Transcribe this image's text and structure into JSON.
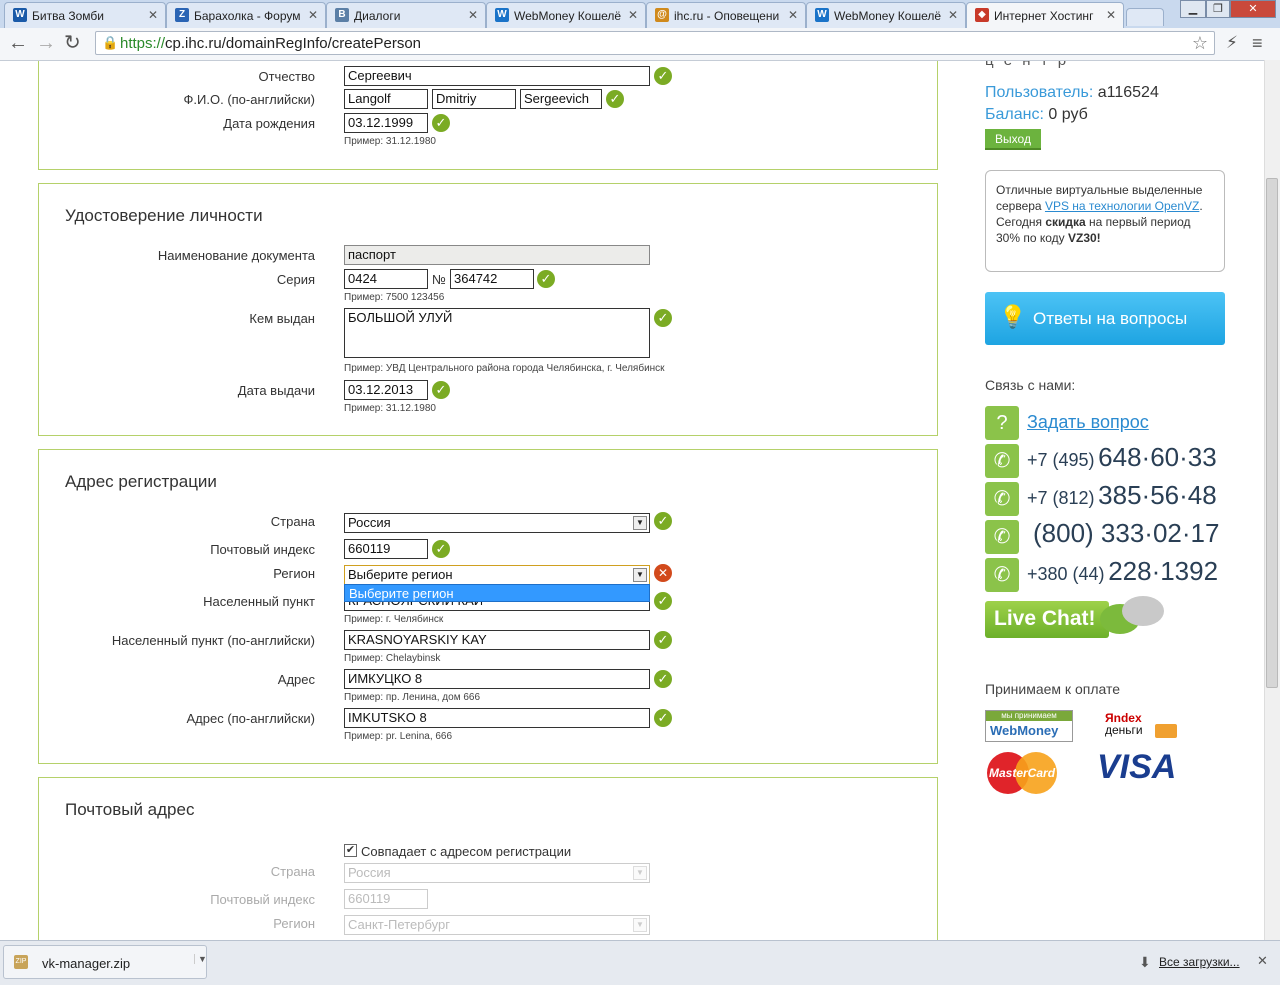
{
  "tabs": [
    {
      "title": "Битва Зомби",
      "icon": "W",
      "color": "#1a5aa8"
    },
    {
      "title": "Барахолка - Форум",
      "icon": "Z",
      "color": "#2a64b4"
    },
    {
      "title": "Диалоги",
      "icon": "В",
      "color": "#5b7fa6"
    },
    {
      "title": "WebMoney Кошелё",
      "icon": "W",
      "color": "#1a73c8"
    },
    {
      "title": "ihc.ru - Оповещени",
      "icon": "@",
      "color": "#d08a1c"
    },
    {
      "title": "WebMoney Кошелё",
      "icon": "W",
      "color": "#1a73c8"
    },
    {
      "title": "Интернет Хостинг",
      "icon": "◆",
      "color": "#c83a2a"
    }
  ],
  "url": {
    "proto": "https://",
    "rest": "cp.ihc.ru/domainRegInfo/createPerson"
  },
  "personal": {
    "patronymic_label": "Отчество",
    "patronymic": "Сергеевич",
    "latin_label": "Ф.И.О. (по-английски)",
    "latin_last": "Langolf",
    "latin_first": "Dmitriy",
    "latin_middle": "Sergeevich",
    "birth_label": "Дата рождения",
    "birth": "03.12.1999",
    "birth_hint": "Пример: 31.12.1980"
  },
  "identity": {
    "title": "Удостоверение личности",
    "doc_label": "Наименование документа",
    "doc": "паспорт",
    "series_label": "Серия",
    "series": "0424",
    "num_sign": "№",
    "number": "364742",
    "series_hint": "Пример: 7500 123456",
    "issued_label": "Кем выдан",
    "issued": "БОЛЬШОЙ УЛУЙ",
    "issued_hint": "Пример: УВД Центрального района города Челябинска, г. Челябинск",
    "date_label": "Дата выдачи",
    "date": "03.12.2013",
    "date_hint": "Пример: 31.12.1980"
  },
  "address": {
    "title": "Адрес регистрации",
    "country_label": "Страна",
    "country": "Россия",
    "zip_label": "Почтовый индекс",
    "zip": "660119",
    "region_label": "Регион",
    "region": "Выберите регион",
    "region_option": "Выберите регион",
    "city_label": "Населенный пункт",
    "city": "КРАСНОЯРСКИЙ КАЙ",
    "city_hint": "Пример: г. Челябинск",
    "city_en_label": "Населенный пункт (по-английски)",
    "city_en": "KRASNOYARSKIY KAY",
    "city_en_hint": "Пример: Chelaybinsk",
    "addr_label": "Адрес",
    "addr": "ИМКУЦКО 8",
    "addr_hint": "Пример: пр. Ленина, дом 666",
    "addr_en_label": "Адрес (по-английски)",
    "addr_en": "IMKUTSKO 8",
    "addr_en_hint": "Пример: pr. Lenina, 666"
  },
  "postal": {
    "title": "Почтовый адрес",
    "same_label": "Совпадает с адресом регистрации",
    "country_label": "Страна",
    "country": "Россия",
    "zip_label": "Почтовый индекс",
    "zip": "660119",
    "region_label": "Регион",
    "region": "Санкт-Петербург"
  },
  "sidebar": {
    "top_text": "ц е н т р",
    "user_label": "Пользователь:",
    "user": "a116524",
    "balance_label": "Баланс:",
    "balance": "0 руб",
    "logout": "Выход",
    "promo_1": "Отличные виртуальные выделенные сервера ",
    "promo_link": "VPS на технологии OpenVZ",
    "promo_2": ". Сегодня ",
    "promo_bold": "скидка",
    "promo_3": " на первый период 30% по коду ",
    "promo_code": "VZ30!",
    "faq": "Ответы на вопросы",
    "contact_label": "Связь с нами:",
    "ask": "Задать вопрос",
    "phones": [
      {
        "small": "+7 (495)",
        "big": "648·60·33"
      },
      {
        "small": "+7 (812)",
        "big": "385·56·48"
      },
      {
        "small": "",
        "big": "(800) 333·02·17"
      },
      {
        "small": "+380 (44)",
        "big": "228·1392"
      }
    ],
    "chat": "Live Chat!",
    "payment_label": "Принимаем к оплате",
    "wm_top": "мы принимаем",
    "wm": "WebMoney",
    "yandex_1": "Яndex",
    "yandex_2": "деньги",
    "mastercard": "MasterCard",
    "visa": "VISA"
  },
  "download": {
    "file": "vk-manager.zip",
    "all": "Все загрузки..."
  }
}
